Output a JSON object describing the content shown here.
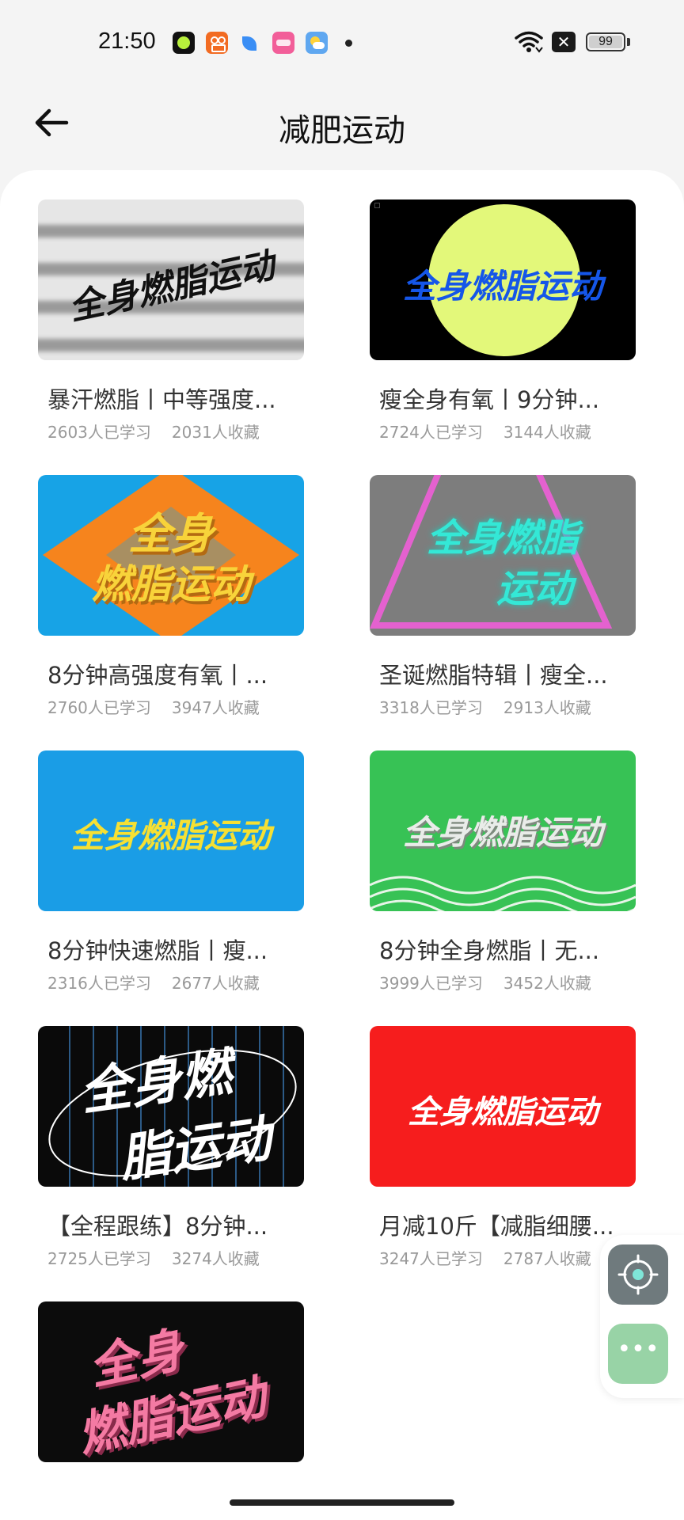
{
  "status_bar": {
    "time": "21:50",
    "app_icons": [
      {
        "name": "dark-circle-app-icon",
        "color": "#1a1a1a"
      },
      {
        "name": "orange-app-icon",
        "color": "#f26b22"
      },
      {
        "name": "blue-leaf-app-icon",
        "color": "#3a8ef5"
      },
      {
        "name": "pink-app-icon",
        "color": "#f25e99"
      },
      {
        "name": "weather-app-icon",
        "color": "#5fa7f0"
      }
    ],
    "battery": "99",
    "battery_level": 0.99
  },
  "header": {
    "title": "减肥运动",
    "back_icon": "arrow-left-icon"
  },
  "cards": [
    {
      "title": "暴汗燃脂丨中等强度...",
      "learners": "2603人已学习",
      "favorites": "2031人收藏",
      "thumb_text": "全身燃脂运动"
    },
    {
      "title": "瘦全身有氧丨9分钟...",
      "learners": "2724人已学习",
      "favorites": "3144人收藏",
      "thumb_text": "全身燃脂运动"
    },
    {
      "title": "8分钟高强度有氧丨...",
      "learners": "2760人已学习",
      "favorites": "3947人收藏",
      "thumb_text_1": "全身",
      "thumb_text_2": "燃脂运动"
    },
    {
      "title": "圣诞燃脂特辑丨瘦全...",
      "learners": "3318人已学习",
      "favorites": "2913人收藏",
      "thumb_text_1": "全身燃脂",
      "thumb_text_2": "运动"
    },
    {
      "title": "8分钟快速燃脂丨瘦...",
      "learners": "2316人已学习",
      "favorites": "2677人收藏",
      "thumb_text": "全身燃脂运动"
    },
    {
      "title": "8分钟全身燃脂丨无...",
      "learners": "3999人已学习",
      "favorites": "3452人收藏",
      "thumb_text": "全身燃脂运动"
    },
    {
      "title": "【全程跟练】8分钟...",
      "learners": "2725人已学习",
      "favorites": "3274人收藏",
      "thumb_text_1": "全身燃",
      "thumb_text_2": "脂运动"
    },
    {
      "title": "月减10斤【减脂细腰...",
      "learners": "3247人已学习",
      "favorites": "2787人收藏",
      "thumb_text": "全身燃脂运动"
    },
    {
      "title": "",
      "learners": "",
      "favorites": "",
      "thumb_text_1": "全身",
      "thumb_text_2": "燃脂运动"
    }
  ],
  "floating": {
    "target_icon": "crosshair-icon",
    "more_icon": "more-dots-icon",
    "more_label": "•••"
  },
  "colors": {
    "card2_bg": "#000000",
    "card2_circle": "#e3f87a",
    "card2_text": "#1556e8",
    "card3_bg": "#17a3e6",
    "card3_diamond": "#f6841d",
    "card3_text": "#f8d33a",
    "card4_bg": "#7d7d7d",
    "card4_text": "#34e8d6",
    "card4_triangle": "#f05ed8",
    "card5_bg": "#1a9de6",
    "card5_text": "#f6e033",
    "card6_bg": "#37c255",
    "card8_bg": "#f61d1d",
    "card9_text": "#f47aa3"
  }
}
